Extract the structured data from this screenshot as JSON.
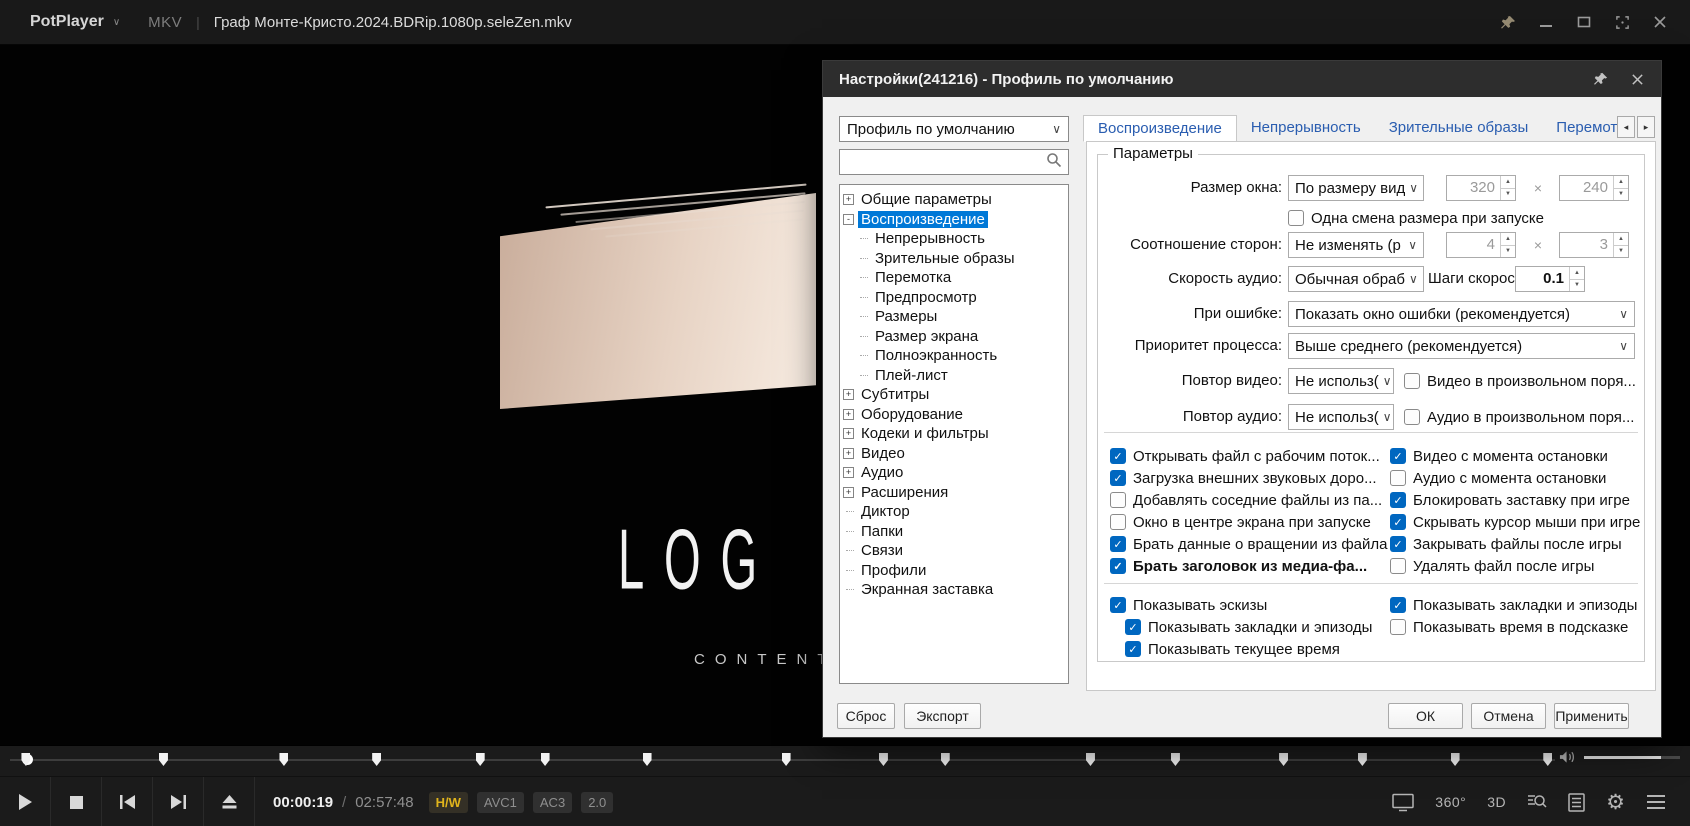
{
  "titlebar": {
    "app": "PotPlayer",
    "format": "MKV",
    "separator": "|",
    "filename": "Граф Монте-Кристо.2024.BDRip.1080p.seleZen.mkv"
  },
  "video": {
    "logo": "LOG",
    "subtitle": "CONTENT"
  },
  "dialog": {
    "title": "Настройки(241216) - Профиль по умолчанию",
    "profile": "Профиль по умолчанию",
    "tabs": [
      {
        "label": "Воспроизведение",
        "active": true
      },
      {
        "label": "Непрерывность",
        "active": false
      },
      {
        "label": "Зрительные образы",
        "active": false
      },
      {
        "label": "Перемотка",
        "active": false
      }
    ],
    "tree": [
      {
        "label": "Общие параметры",
        "glyph": "+",
        "indent": 0
      },
      {
        "label": "Воспроизведение",
        "glyph": "-",
        "indent": 0,
        "selected": true
      },
      {
        "label": "Непрерывность",
        "indent": 1
      },
      {
        "label": "Зрительные образы",
        "indent": 1
      },
      {
        "label": "Перемотка",
        "indent": 1
      },
      {
        "label": "Предпросмотр",
        "indent": 1
      },
      {
        "label": "Размеры",
        "indent": 1
      },
      {
        "label": "Размер экрана",
        "indent": 1
      },
      {
        "label": "Полноэкранность",
        "indent": 1
      },
      {
        "label": "Плей-лист",
        "indent": 1
      },
      {
        "label": "Субтитры",
        "glyph": "+",
        "indent": 0
      },
      {
        "label": "Оборудование",
        "glyph": "+",
        "indent": 0
      },
      {
        "label": "Кодеки и фильтры",
        "glyph": "+",
        "indent": 0
      },
      {
        "label": "Видео",
        "glyph": "+",
        "indent": 0
      },
      {
        "label": "Аудио",
        "glyph": "+",
        "indent": 0
      },
      {
        "label": "Расширения",
        "glyph": "+",
        "indent": 0
      },
      {
        "label": "Диктор",
        "indent": 0
      },
      {
        "label": "Папки",
        "indent": 0
      },
      {
        "label": "Связи",
        "indent": 0
      },
      {
        "label": "Профили",
        "indent": 0
      },
      {
        "label": "Экранная заставка",
        "indent": 0
      }
    ],
    "group_title": "Параметры",
    "form": {
      "window_size": {
        "label": "Размер окна:",
        "value": "По размеру вид",
        "w": "320",
        "times": "×",
        "h": "240"
      },
      "resize_once": {
        "label": "Одна смена размера при запуске",
        "checked": false
      },
      "aspect": {
        "label": "Соотношение сторон:",
        "value": "Не изменять (p",
        "w": "4",
        "times": "×",
        "h": "3"
      },
      "audio_speed": {
        "label": "Скорость аудио:",
        "value": "Обычная обраб",
        "steps_label": "Шаги скорости:",
        "steps_value": "0.1"
      },
      "on_error": {
        "label": "При ошибке:",
        "value": "Показать окно ошибки (рекомендуется)"
      },
      "priority": {
        "label": "Приоритет процесса:",
        "value": "Выше среднего (рекомендуется)"
      },
      "video_repeat": {
        "label": "Повтор видео:",
        "value": "Не использ(",
        "check_label": "Видео в произвольном поря...",
        "checked": false
      },
      "audio_repeat": {
        "label": "Повтор аудио:",
        "value": "Не использ(",
        "check_label": "Аудио в произвольном поря...",
        "checked": false
      }
    },
    "options_left": [
      {
        "label": "Открывать файл с рабочим поток...",
        "checked": true
      },
      {
        "label": "Загрузка внешних звуковых доро...",
        "checked": true
      },
      {
        "label": "Добавлять соседние файлы из па...",
        "checked": false
      },
      {
        "label": "Окно в центре экрана при запуске",
        "checked": false
      },
      {
        "label": "Брать данные о вращении из файла",
        "checked": true
      },
      {
        "label": "Брать заголовок из медиа-фа...",
        "checked": true,
        "bold": true
      }
    ],
    "options_right": [
      {
        "label": "Видео с момента остановки",
        "checked": true
      },
      {
        "label": "Аудио с момента остановки",
        "checked": false
      },
      {
        "label": "Блокировать заставку при игре",
        "checked": true
      },
      {
        "label": "Скрывать курсор мыши при игре",
        "checked": true
      },
      {
        "label": "Закрывать файлы после игры",
        "checked": true
      },
      {
        "label": "Удалять файл после игры",
        "checked": false
      }
    ],
    "thumbs_left": [
      {
        "label": "Показывать эскизы",
        "checked": true,
        "indent": 0
      },
      {
        "label": "Показывать закладки и эпизоды",
        "checked": true,
        "indent": 1
      },
      {
        "label": "Показывать текущее время",
        "checked": true,
        "indent": 1
      }
    ],
    "thumbs_right": [
      {
        "label": "Показывать закладки и эпизоды",
        "checked": true
      },
      {
        "label": "Показывать время в подсказке",
        "checked": false
      }
    ],
    "footer": {
      "reset": "Сброс",
      "export": "Экспорт",
      "ok": "ОК",
      "cancel": "Отмена",
      "apply": "Применить"
    }
  },
  "player": {
    "time_current": "00:00:19",
    "time_separator": "/",
    "time_total": "02:57:48",
    "badges": [
      {
        "label": "H/W",
        "accent": true
      },
      {
        "label": "AVC1",
        "accent": false
      },
      {
        "label": "AC3",
        "accent": false
      },
      {
        "label": "2.0",
        "accent": false
      }
    ],
    "markers_pct": [
      1.0,
      9.9,
      17.7,
      23.7,
      30.4,
      34.6,
      41.2,
      50.2,
      56.5,
      60.5,
      69.9,
      75.4,
      82.4,
      87.5,
      93.5,
      99.5
    ],
    "volume_pct": 80,
    "label_360": "360°",
    "label_3d": "3D"
  },
  "colors": {
    "accent_blue": "#0067c0",
    "selection_blue": "#0078d7",
    "badge_yellow": "#e0b41c"
  }
}
